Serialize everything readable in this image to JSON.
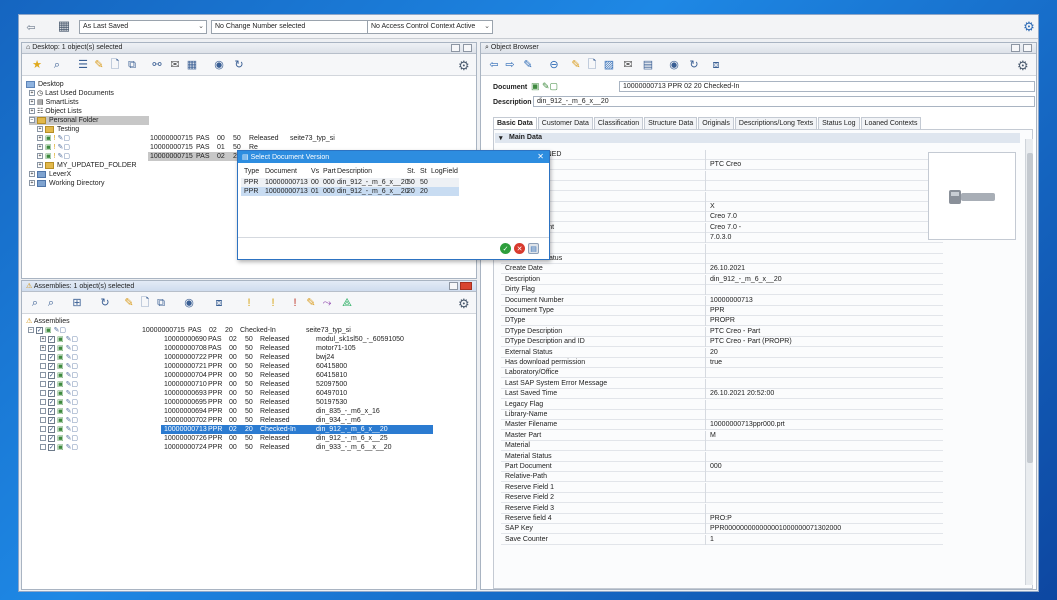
{
  "toolbar": {
    "combo1": "As Last Saved",
    "combo2": "No Change Number selected",
    "combo3": "No Access Control Context Active"
  },
  "desktop_panel": {
    "title": "Desktop: 1 object(s) selected",
    "tree": {
      "root": "Desktop",
      "last_used": "Last Used Documents",
      "smartlists": "SmartLists",
      "object_lists": "Object Lists",
      "personal_folder": "Personal Folder",
      "testing": "Testing",
      "docs": [
        {
          "num": "10000000715",
          "type": "PAS",
          "vs": "00",
          "st": "50",
          "status": "Released",
          "desc": "seite73_typ_si"
        },
        {
          "num": "10000000715",
          "type": "PAS",
          "vs": "01",
          "st": "50",
          "status": "Re",
          "desc": ""
        },
        {
          "num": "10000000715",
          "type": "PAS",
          "vs": "02",
          "st": "20",
          "status": "Ch",
          "desc": ""
        }
      ],
      "my_updated": "MY_UPDATED_FOLDER",
      "leverx": "LeverX",
      "working_dir": "Working Directory"
    }
  },
  "dialog": {
    "title": "Select Document Version",
    "headers": [
      "Type",
      "Document",
      "Vs",
      "Part",
      "Description",
      "St.",
      "St",
      "LogField"
    ],
    "rows": [
      {
        "type": "PPR",
        "doc": "10000000713",
        "vs": "00",
        "part": "000",
        "desc": "din_912_-_m_6_x__20",
        "st1": "50",
        "st2": "50"
      },
      {
        "type": "PPR",
        "doc": "10000000713",
        "vs": "01",
        "part": "000",
        "desc": "din_912_-_m_6_x__20",
        "st1": "20",
        "st2": "20"
      }
    ]
  },
  "assemblies_panel": {
    "title": "Assemblies: 1 object(s) selected",
    "root": "Assemblies",
    "top": {
      "num": "10000000715",
      "type": "PAS",
      "vs": "02",
      "st": "20",
      "status": "Checked-In",
      "desc": "seite73_typ_si"
    },
    "items": [
      {
        "num": "10000000690",
        "type": "PAS",
        "vs": "02",
        "st": "50",
        "status": "Released",
        "desc": "modul_sk1sl50_-_60591050"
      },
      {
        "num": "10000000708",
        "type": "PAS",
        "vs": "00",
        "st": "50",
        "status": "Released",
        "desc": "motor71-105"
      },
      {
        "num": "10000000722",
        "type": "PPR",
        "vs": "00",
        "st": "50",
        "status": "Released",
        "desc": "bwj24"
      },
      {
        "num": "10000000721",
        "type": "PPR",
        "vs": "00",
        "st": "50",
        "status": "Released",
        "desc": "60415800"
      },
      {
        "num": "10000000704",
        "type": "PPR",
        "vs": "00",
        "st": "50",
        "status": "Released",
        "desc": "60415810"
      },
      {
        "num": "10000000710",
        "type": "PPR",
        "vs": "00",
        "st": "50",
        "status": "Released",
        "desc": "52097500"
      },
      {
        "num": "10000000693",
        "type": "PPR",
        "vs": "00",
        "st": "50",
        "status": "Released",
        "desc": "60497010"
      },
      {
        "num": "10000000695",
        "type": "PPR",
        "vs": "00",
        "st": "50",
        "status": "Released",
        "desc": "50197530"
      },
      {
        "num": "10000000694",
        "type": "PPR",
        "vs": "00",
        "st": "50",
        "status": "Released",
        "desc": "din_835_-_m6_x_16"
      },
      {
        "num": "10000000702",
        "type": "PPR",
        "vs": "00",
        "st": "50",
        "status": "Released",
        "desc": "din_934_-_m6"
      },
      {
        "num": "10000000713",
        "type": "PPR",
        "vs": "02",
        "st": "20",
        "status": "Checked-In",
        "desc": "din_912_-_m_6_x__20"
      },
      {
        "num": "10000000726",
        "type": "PPR",
        "vs": "00",
        "st": "50",
        "status": "Released",
        "desc": "din_912_-_m_6_x__25"
      },
      {
        "num": "10000000724",
        "type": "PPR",
        "vs": "00",
        "st": "50",
        "status": "Released",
        "desc": "din_933_-_m_6__x__20"
      }
    ]
  },
  "object_browser": {
    "title": "Object Browser",
    "document_label": "Document",
    "document_value": "10000000713 PPR 02 20 Checked-In",
    "description_label": "Description",
    "description_value": "din_912_-_m_6_x__20",
    "tabs": [
      "Basic Data",
      "Customer Data",
      "Classification",
      "Structure Data",
      "Originals",
      "Descriptions/Long Texts",
      "Status Log",
      "Loaned Contexts"
    ],
    "section": "Main Data",
    "rows": [
      {
        "k": "l Context OWNED",
        "v": ""
      },
      {
        "k": "pe",
        "v": "PTC Creo"
      },
      {
        "k": "",
        "v": ""
      },
      {
        "k": "Group",
        "v": ""
      },
      {
        "k": "ent",
        "v": ""
      },
      {
        "k": "",
        "v": "X"
      },
      {
        "k": "",
        "v": "Creo 7.0"
      },
      {
        "k": "nd Environment",
        "v": "Creo 7.0 -"
      },
      {
        "k": "xt",
        "v": "7.0.3.0"
      },
      {
        "k": "er",
        "v": ""
      },
      {
        "k": "Conversion Status",
        "v": ""
      },
      {
        "k": "Create Date",
        "v": "26.10.2021"
      },
      {
        "k": "Description",
        "v": "din_912_-_m_6_x__20"
      },
      {
        "k": "Dirty Flag",
        "v": ""
      },
      {
        "k": "Document Number",
        "v": "10000000713"
      },
      {
        "k": "Document Type",
        "v": "PPR"
      },
      {
        "k": "DType",
        "v": "PROPR"
      },
      {
        "k": "DType Description",
        "v": "PTC Creo - Part"
      },
      {
        "k": "DType Description and ID",
        "v": "PTC Creo - Part (PROPR)"
      },
      {
        "k": "External Status",
        "v": "20"
      },
      {
        "k": "Has download permission",
        "v": "true"
      },
      {
        "k": "Laboratory/Office",
        "v": ""
      },
      {
        "k": "Last SAP System Error Message",
        "v": ""
      },
      {
        "k": "Last Saved Time",
        "v": "26.10.2021 20:52:00"
      },
      {
        "k": "Legacy Flag",
        "v": ""
      },
      {
        "k": "Library-Name",
        "v": ""
      },
      {
        "k": "Master Filename",
        "v": "10000000713ppr000.prt"
      },
      {
        "k": "Master Part",
        "v": "M"
      },
      {
        "k": "Material",
        "v": ""
      },
      {
        "k": "Material Status",
        "v": ""
      },
      {
        "k": "Part Document",
        "v": "000"
      },
      {
        "k": "Relative-Path",
        "v": ""
      },
      {
        "k": "Reserve Field 1",
        "v": ""
      },
      {
        "k": "Reserve Field 2",
        "v": ""
      },
      {
        "k": "Reserve Field 3",
        "v": ""
      },
      {
        "k": "Reserve field 4",
        "v": "PRO:P"
      },
      {
        "k": "SAP Key",
        "v": "PPR000000000000001000000071302000"
      },
      {
        "k": "Save Counter",
        "v": "1"
      }
    ]
  },
  "colors": {
    "accent": "#2d8de0",
    "selection": "#2b7bd1",
    "background": "#1565c0"
  }
}
